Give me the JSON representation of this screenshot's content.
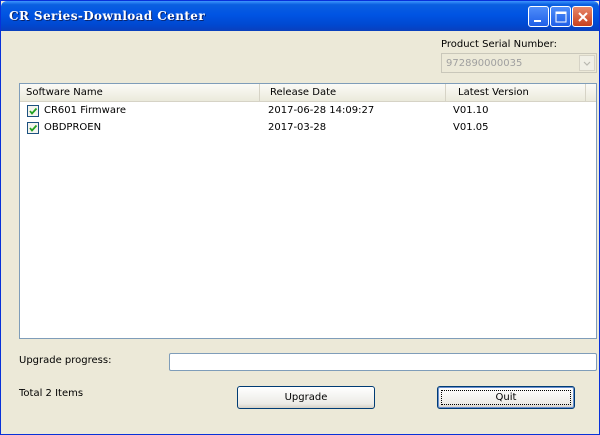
{
  "window": {
    "title": "CR Series-Download Center"
  },
  "serial": {
    "label": "Product Serial Number:",
    "value": "972890000035"
  },
  "table": {
    "columns": [
      "Software Name",
      "Release Date",
      "Latest Version"
    ],
    "rows": [
      {
        "checked": true,
        "name": "CR601 Firmware",
        "date": "2017-06-28 14:09:27",
        "version": "V01.10"
      },
      {
        "checked": true,
        "name": "OBDPROEN",
        "date": "2017-03-28",
        "version": "V01.05"
      }
    ]
  },
  "progress": {
    "label": "Upgrade progress:",
    "percent": 0
  },
  "footer": {
    "total": "Total 2 Items",
    "upgrade_label": "Upgrade",
    "quit_label": "Quit"
  },
  "colors": {
    "titlebar": "#0054e3",
    "window_bg": "#ece9d8",
    "close_button": "#c8401e",
    "checkbox_tick": "#21a121"
  },
  "icons": {
    "minimize": "minimize-icon",
    "maximize": "maximize-icon",
    "close": "close-icon",
    "dropdown": "chevron-down-icon",
    "checkbox": "checkmark-icon"
  }
}
